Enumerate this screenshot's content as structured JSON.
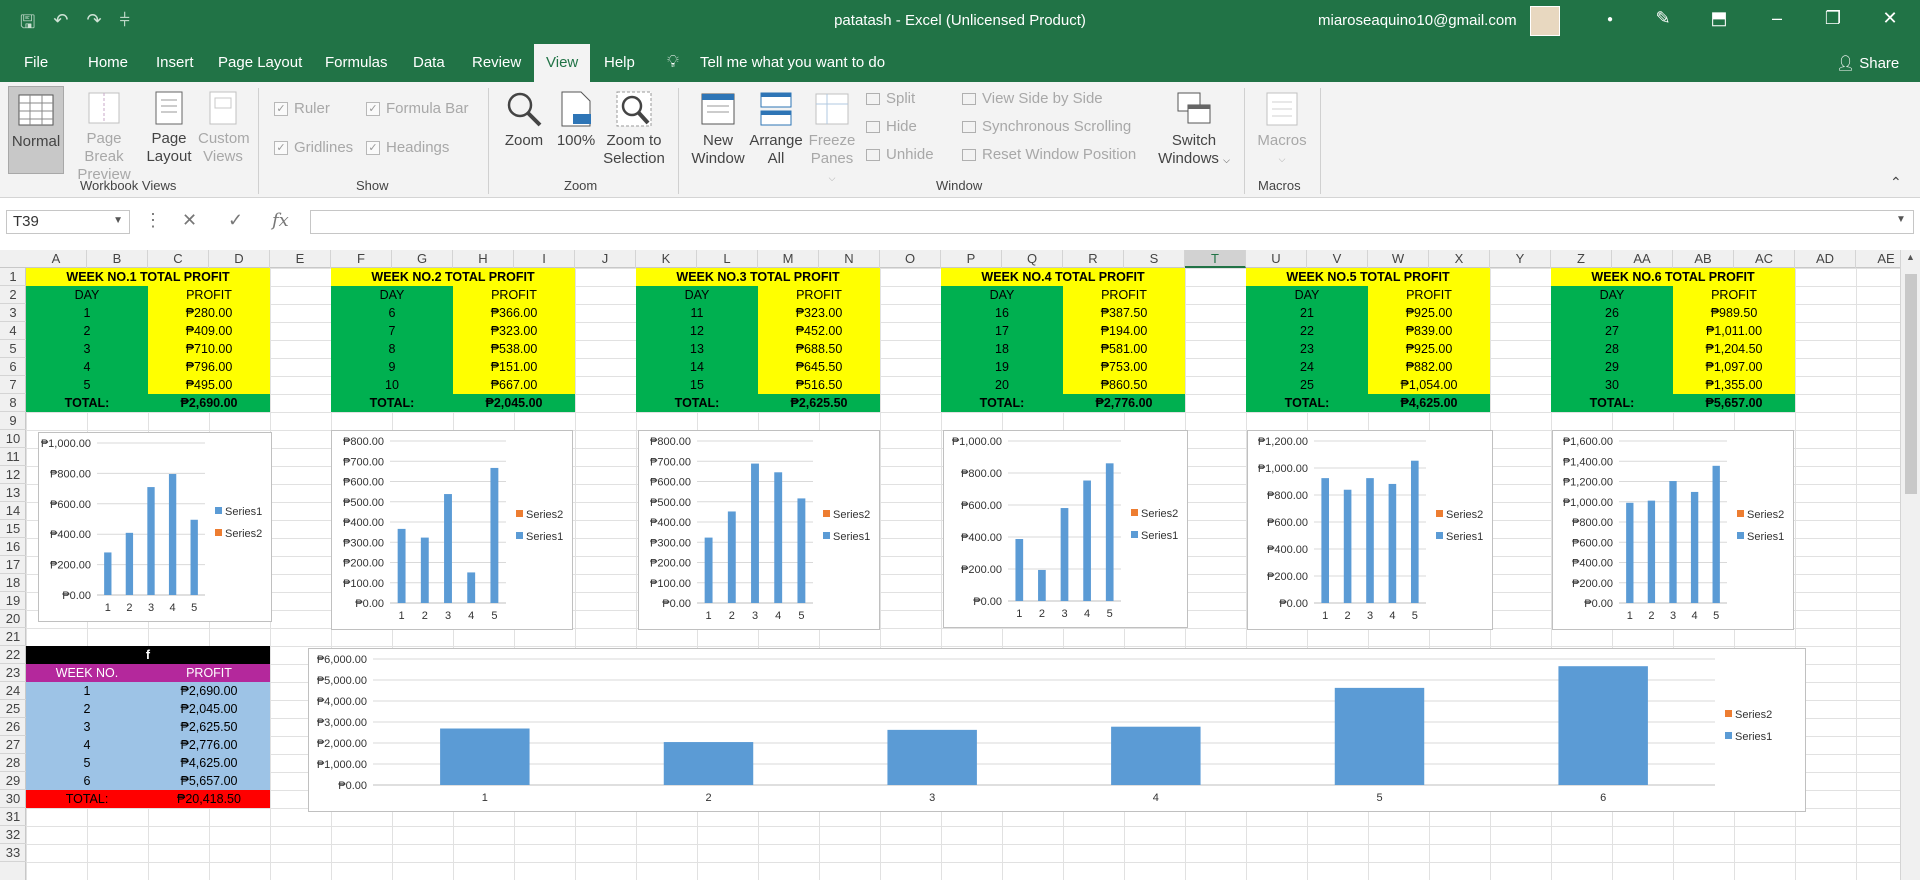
{
  "window": {
    "title": "patatash  -  Excel (Unlicensed Product)",
    "user": "miaroseaquino10@gmail.com"
  },
  "menu": {
    "tabs": [
      "File",
      "Home",
      "Insert",
      "Page Layout",
      "Formulas",
      "Data",
      "Review",
      "View",
      "Help"
    ],
    "active_tab": "View",
    "tell_me": "Tell me what you want to do",
    "share": "Share"
  },
  "ribbon": {
    "workbook_views": {
      "label": "Workbook Views",
      "normal": "Normal",
      "page_break_preview": [
        "Page Break",
        "Preview"
      ],
      "page_layout": [
        "Page",
        "Layout"
      ],
      "custom_views": [
        "Custom",
        "Views"
      ]
    },
    "show": {
      "label": "Show",
      "ruler": "Ruler",
      "formula_bar": "Formula Bar",
      "gridlines": "Gridlines",
      "headings": "Headings"
    },
    "zoom": {
      "label": "Zoom",
      "zoom": "Zoom",
      "hundred": "100%",
      "to_selection": [
        "Zoom to",
        "Selection"
      ]
    },
    "window": {
      "label": "Window",
      "new_window": [
        "New",
        "Window"
      ],
      "arrange_all": [
        "Arrange",
        "All"
      ],
      "freeze_panes": [
        "Freeze",
        "Panes"
      ],
      "split": "Split",
      "hide": "Hide",
      "unhide": "Unhide",
      "view_side": "View Side by Side",
      "sync_scroll": "Synchronous Scrolling",
      "reset_pos": "Reset Window Position",
      "switch_windows": [
        "Switch",
        "Windows"
      ]
    },
    "macros": {
      "label": "Macros",
      "macros": "Macros"
    }
  },
  "formula_bar": {
    "name_box": "T39",
    "fx": "fx",
    "content": ""
  },
  "columns": [
    "A",
    "B",
    "C",
    "D",
    "E",
    "F",
    "G",
    "H",
    "I",
    "J",
    "K",
    "L",
    "M",
    "N",
    "O",
    "P",
    "Q",
    "R",
    "S",
    "T",
    "U",
    "V",
    "W",
    "X",
    "Y",
    "Z",
    "AA",
    "AB",
    "AC",
    "AD",
    "AE"
  ],
  "selected_column": "T",
  "rows": [
    "1",
    "2",
    "3",
    "4",
    "5",
    "6",
    "7",
    "8",
    "9",
    "10",
    "11",
    "12",
    "13",
    "14",
    "15",
    "16",
    "17",
    "18",
    "19",
    "20",
    "21",
    "22",
    "23",
    "24",
    "25",
    "26",
    "27",
    "28",
    "29",
    "30",
    "31",
    "32",
    "33"
  ],
  "weeks": [
    {
      "title": "WEEK NO.1 TOTAL PROFIT",
      "day_h": "DAY",
      "profit_h": "PROFIT",
      "days": [
        "1",
        "2",
        "3",
        "4",
        "5"
      ],
      "profits": [
        "₱280.00",
        "₱409.00",
        "₱710.00",
        "₱796.00",
        "₱495.00"
      ],
      "total_label": "TOTAL:",
      "total": "₱2,690.00"
    },
    {
      "title": "WEEK NO.2 TOTAL PROFIT",
      "day_h": "DAY",
      "profit_h": "PROFIT",
      "days": [
        "6",
        "7",
        "8",
        "9",
        "10"
      ],
      "profits": [
        "₱366.00",
        "₱323.00",
        "₱538.00",
        "₱151.00",
        "₱667.00"
      ],
      "total_label": "TOTAL:",
      "total": "₱2,045.00"
    },
    {
      "title": "WEEK NO.3 TOTAL PROFIT",
      "day_h": "DAY",
      "profit_h": "PROFIT",
      "days": [
        "11",
        "12",
        "13",
        "14",
        "15"
      ],
      "profits": [
        "₱323.00",
        "₱452.00",
        "₱688.50",
        "₱645.50",
        "₱516.50"
      ],
      "total_label": "TOTAL:",
      "total": "₱2,625.50"
    },
    {
      "title": "WEEK NO.4 TOTAL PROFIT",
      "day_h": "DAY",
      "profit_h": "PROFIT",
      "days": [
        "16",
        "17",
        "18",
        "19",
        "20"
      ],
      "profits": [
        "₱387.50",
        "₱194.00",
        "₱581.00",
        "₱753.00",
        "₱860.50"
      ],
      "total_label": "TOTAL:",
      "total": "₱2,776.00"
    },
    {
      "title": "WEEK NO.5 TOTAL PROFIT",
      "day_h": "DAY",
      "profit_h": "PROFIT",
      "days": [
        "21",
        "22",
        "23",
        "24",
        "25"
      ],
      "profits": [
        "₱925.00",
        "₱839.00",
        "₱925.00",
        "₱882.00",
        "₱1,054.00"
      ],
      "total_label": "TOTAL:",
      "total": "₱4,625.00"
    },
    {
      "title": "WEEK NO.6 TOTAL PROFIT",
      "day_h": "DAY",
      "profit_h": "PROFIT",
      "days": [
        "26",
        "27",
        "28",
        "29",
        "30"
      ],
      "profits": [
        "₱989.50",
        "₱1,011.00",
        "₱1,204.50",
        "₱1,097.00",
        "₱1,355.00"
      ],
      "total_label": "TOTAL:",
      "total": "₱5,657.00"
    }
  ],
  "summary": {
    "header": "f",
    "week_h": "WEEK NO.",
    "profit_h": "PROFIT",
    "weeks": [
      "1",
      "2",
      "3",
      "4",
      "5",
      "6"
    ],
    "profits": [
      "₱2,690.00",
      "₱2,045.00",
      "₱2,625.50",
      "₱2,776.00",
      "₱4,625.00",
      "₱5,657.00"
    ],
    "total_label": "TOTAL:",
    "total": "₱20,418.50"
  },
  "chart_data": [
    {
      "type": "bar",
      "categories": [
        "1",
        "2",
        "3",
        "4",
        "5"
      ],
      "series": [
        {
          "name": "Series1",
          "values": [
            280,
            409,
            710,
            796,
            495
          ]
        },
        {
          "name": "Series2",
          "values": []
        }
      ],
      "ylim": [
        0,
        1000
      ],
      "yticks": [
        "₱0.00",
        "₱200.00",
        "₱400.00",
        "₱600.00",
        "₱800.00",
        "₱1,000.00"
      ],
      "legend": "right",
      "legend_order": [
        "Series1",
        "Series2"
      ],
      "grid": true
    },
    {
      "type": "bar",
      "categories": [
        "1",
        "2",
        "3",
        "4",
        "5"
      ],
      "series": [
        {
          "name": "Series1",
          "values": [
            366,
            323,
            538,
            151,
            667
          ]
        },
        {
          "name": "Series2",
          "values": []
        }
      ],
      "ylim": [
        0,
        800
      ],
      "yticks": [
        "₱0.00",
        "₱100.00",
        "₱200.00",
        "₱300.00",
        "₱400.00",
        "₱500.00",
        "₱600.00",
        "₱700.00",
        "₱800.00"
      ],
      "legend": "right",
      "legend_order": [
        "Series2",
        "Series1"
      ],
      "grid": true
    },
    {
      "type": "bar",
      "categories": [
        "1",
        "2",
        "3",
        "4",
        "5"
      ],
      "series": [
        {
          "name": "Series1",
          "values": [
            323,
            452,
            688.5,
            645.5,
            516.5
          ]
        },
        {
          "name": "Series2",
          "values": []
        }
      ],
      "ylim": [
        0,
        800
      ],
      "yticks": [
        "₱0.00",
        "₱100.00",
        "₱200.00",
        "₱300.00",
        "₱400.00",
        "₱500.00",
        "₱600.00",
        "₱700.00",
        "₱800.00"
      ],
      "legend": "right",
      "legend_order": [
        "Series2",
        "Series1"
      ],
      "grid": true
    },
    {
      "type": "bar",
      "categories": [
        "1",
        "2",
        "3",
        "4",
        "5"
      ],
      "series": [
        {
          "name": "Series1",
          "values": [
            387.5,
            194,
            581,
            753,
            860.5
          ]
        },
        {
          "name": "Series2",
          "values": []
        }
      ],
      "ylim": [
        0,
        1000
      ],
      "yticks": [
        "₱0.00",
        "₱200.00",
        "₱400.00",
        "₱600.00",
        "₱800.00",
        "₱1,000.00"
      ],
      "legend": "right",
      "legend_order": [
        "Series2",
        "Series1"
      ],
      "grid": true
    },
    {
      "type": "bar",
      "categories": [
        "1",
        "2",
        "3",
        "4",
        "5"
      ],
      "series": [
        {
          "name": "Series1",
          "values": [
            925,
            839,
            925,
            882,
            1054
          ]
        },
        {
          "name": "Series2",
          "values": []
        }
      ],
      "ylim": [
        0,
        1200
      ],
      "yticks": [
        "₱0.00",
        "₱200.00",
        "₱400.00",
        "₱600.00",
        "₱800.00",
        "₱1,000.00",
        "₱1,200.00"
      ],
      "legend": "right",
      "legend_order": [
        "Series2",
        "Series1"
      ],
      "grid": true
    },
    {
      "type": "bar",
      "categories": [
        "1",
        "2",
        "3",
        "4",
        "5"
      ],
      "series": [
        {
          "name": "Series1",
          "values": [
            989.5,
            1011,
            1204.5,
            1097,
            1355
          ]
        },
        {
          "name": "Series2",
          "values": []
        }
      ],
      "ylim": [
        0,
        1600
      ],
      "yticks": [
        "₱0.00",
        "₱200.00",
        "₱400.00",
        "₱600.00",
        "₱800.00",
        "₱1,000.00",
        "₱1,200.00",
        "₱1,400.00",
        "₱1,600.00"
      ],
      "legend": "right",
      "legend_order": [
        "Series2",
        "Series1"
      ],
      "grid": true
    },
    {
      "type": "bar",
      "categories": [
        "1",
        "2",
        "3",
        "4",
        "5",
        "6"
      ],
      "series": [
        {
          "name": "Series1",
          "values": [
            2690,
            2045,
            2625.5,
            2776,
            4625,
            5657
          ]
        },
        {
          "name": "Series2",
          "values": []
        }
      ],
      "ylim": [
        0,
        6000
      ],
      "yticks": [
        "₱0.00",
        "₱1,000.00",
        "₱2,000.00",
        "₱3,000.00",
        "₱4,000.00",
        "₱5,000.00",
        "₱6,000.00"
      ],
      "legend": "right",
      "legend_order": [
        "Series2",
        "Series1"
      ],
      "grid": true
    }
  ],
  "colors": {
    "excel_green": "#217346",
    "series1": "#5b9bd5",
    "series2": "#ed7d31"
  }
}
